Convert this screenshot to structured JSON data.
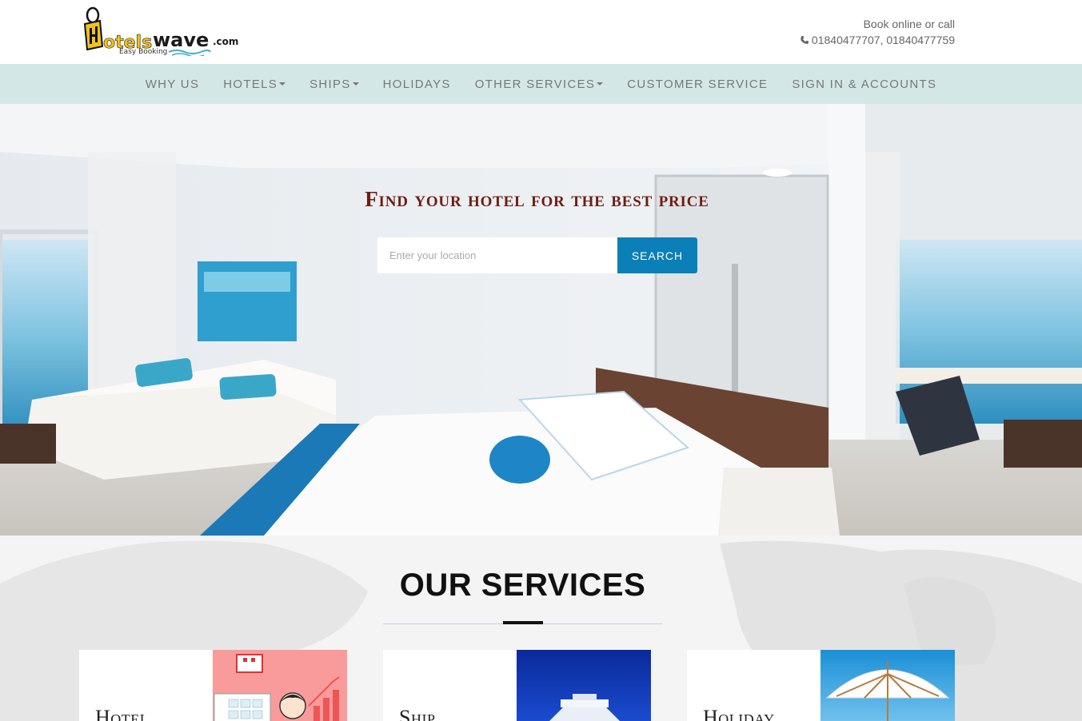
{
  "brand": {
    "logo_text": "Hotelswave",
    "logo_suffix": ".com",
    "logo_tagline": "Easy Booking"
  },
  "contact": {
    "line1": "Book online or call",
    "phones": "01840477707, 01840477759",
    "icon": "phone-icon"
  },
  "nav": {
    "items": [
      {
        "label": "WHY US",
        "dropdown": false
      },
      {
        "label": "HOTELS",
        "dropdown": true
      },
      {
        "label": "SHIPS",
        "dropdown": true
      },
      {
        "label": "HOLIDAYS",
        "dropdown": false
      },
      {
        "label": "OTHER SERVICES",
        "dropdown": true
      },
      {
        "label": "CUSTOMER SERVICE",
        "dropdown": false
      },
      {
        "label": "SIGN IN & ACCOUNTS",
        "dropdown": false
      }
    ]
  },
  "hero": {
    "title": "Find your hotel for the best price",
    "search_placeholder": "Enter your location",
    "search_value": "",
    "search_button": "SEARCH"
  },
  "services": {
    "title": "OUR SERVICES",
    "cards": [
      {
        "label": "Hotel"
      },
      {
        "label": "Ship"
      },
      {
        "label": "Holiday"
      }
    ]
  },
  "colors": {
    "nav_bg": "#d3e8e6",
    "hero_title": "#6f1d12",
    "search_button": "#0a7fb8"
  }
}
